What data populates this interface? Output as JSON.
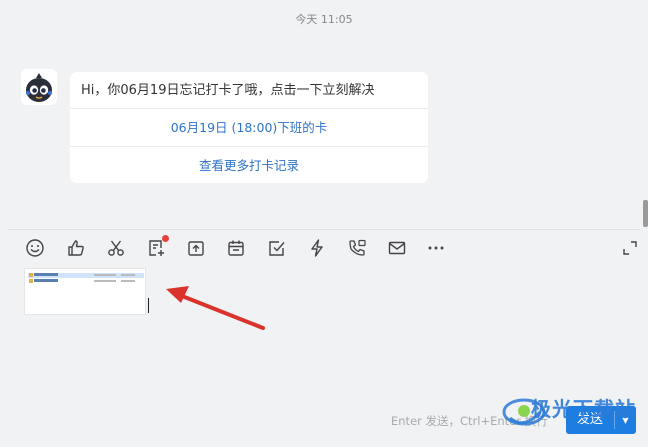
{
  "chat": {
    "timestamp": "今天 11:05",
    "card": {
      "message": "Hi，你06月19日忘记打卡了哦，点击一下立刻解决",
      "primary_link": "06月19日 (18:00)下班的卡",
      "secondary_link": "查看更多打卡记录"
    }
  },
  "toolbar": {
    "icons": [
      "emoji-icon",
      "thumbs-up-icon",
      "scissors-icon",
      "note-add-icon",
      "upload-icon",
      "calendar-icon",
      "checkbox-icon",
      "lightning-icon",
      "phone-icon",
      "mail-icon",
      "more-icon",
      "expand-icon"
    ],
    "note_has_notification": true
  },
  "input": {
    "hint": "Enter 发送，Ctrl+Enter 换行",
    "send_label": "发送",
    "attachment": "image-thumbnail"
  },
  "watermark": {
    "text": "极光下载站"
  },
  "colors": {
    "accent": "#1e7de0",
    "link": "#2e73c9",
    "background": "#f1f2f4",
    "notification": "#e64340",
    "annotation_arrow": "#d9332c"
  }
}
